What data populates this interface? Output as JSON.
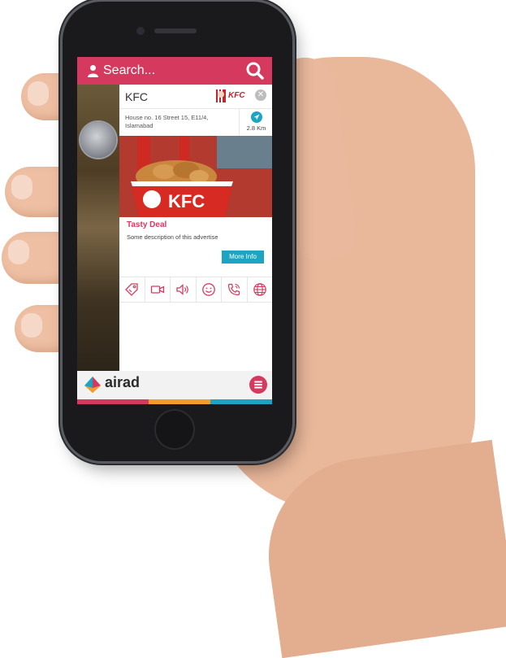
{
  "search": {
    "placeholder": "Search..."
  },
  "listing": {
    "name": "KFC",
    "address": "House no. 16 Street 15, E11/4, Islamabad",
    "distance": "2.8 Km",
    "deal_title": "Tasty Deal",
    "deal_description": "Some description of this advertise",
    "more_info_label": "More Info",
    "photo_text": "KFC"
  },
  "brand": {
    "logo_text": "KFC",
    "app_name": "airad"
  },
  "actions": [
    "tag-icon",
    "video-icon",
    "speaker-icon",
    "smile-icon",
    "phone-icon",
    "globe-icon"
  ],
  "colors": {
    "primary": "#d53a5e",
    "accent": "#1ca4c2",
    "stripe_pink": "#d53a5e",
    "stripe_orange": "#f39c2a",
    "stripe_blue": "#1ca4c2"
  }
}
